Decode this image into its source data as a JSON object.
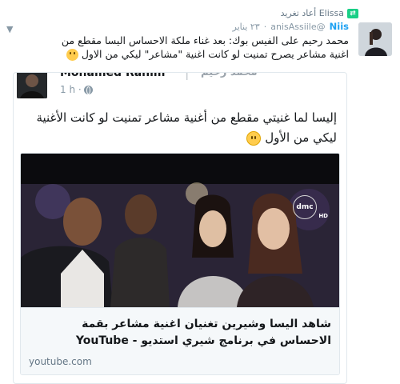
{
  "retweet": {
    "label": "Elissa أعاد تغريد"
  },
  "tweet": {
    "name": "Niis",
    "handle": "@anisAssiile",
    "dot": "·",
    "time": "٢٣ يناير",
    "text_line1": "محمد رحيم على الفيس بوك: بعد غناء ملكة الاحساس اليسا مقطع من",
    "text_line2": "اغنية مشاعر يصرح  تمنيت لو كانت اغنية \"مشاعر\" ليكي من الاول"
  },
  "quoted": {
    "name": "Mohamed Rahim",
    "separator": "|",
    "name_ar": "محمد رحيم",
    "time": "1 h ·",
    "text": "إليسا لما غنيتي مقطع من أغنية مشاعر تمنيت لو كانت الأغنية ليكي من الأول"
  },
  "link_card": {
    "channel_logo": "dmc",
    "channel_tag": "HD",
    "title": "شاهد اليسا وشيرين تغنيان اغنية مشاعر بقمة الاحساس في برنامج شيري استديو - YouTube",
    "domain": "youtube.com"
  },
  "icons": {
    "retweet": "retweet-icon",
    "caret": "chevron-down-icon",
    "globe": "globe-icon",
    "emoji": "smiling-face-icon"
  },
  "colors": {
    "accent": "#1da1f2",
    "retweet_green": "#19cf86",
    "muted": "#8899a6"
  }
}
